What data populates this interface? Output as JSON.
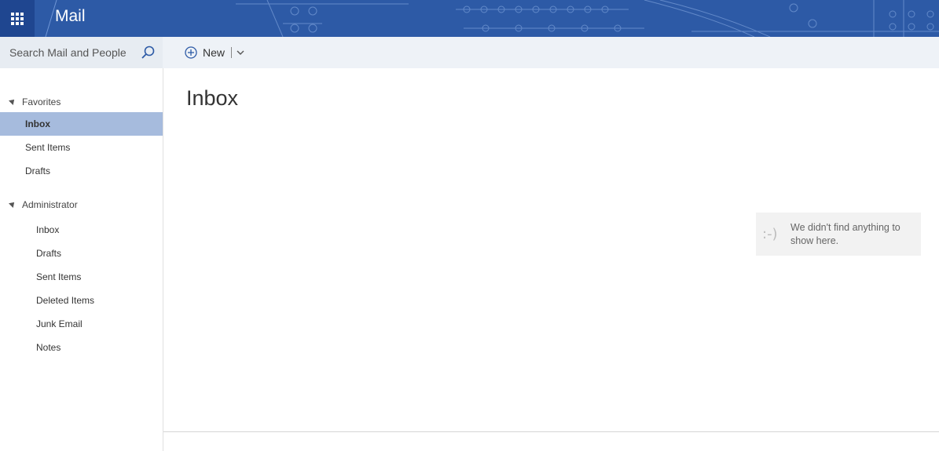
{
  "app": {
    "title": "Mail"
  },
  "search": {
    "placeholder": "Search Mail and People"
  },
  "toolbar": {
    "new_label": "New"
  },
  "sidebar": {
    "favorites": {
      "label": "Favorites",
      "items": [
        {
          "label": "Inbox",
          "selected": true
        },
        {
          "label": "Sent Items"
        },
        {
          "label": "Drafts"
        }
      ]
    },
    "account": {
      "label": "Administrator",
      "items": [
        {
          "label": "Inbox"
        },
        {
          "label": "Drafts"
        },
        {
          "label": "Sent Items"
        },
        {
          "label": "Deleted Items"
        },
        {
          "label": "Junk Email"
        },
        {
          "label": "Notes"
        }
      ]
    }
  },
  "main": {
    "folder_title": "Inbox",
    "empty_icon": ":-)",
    "empty_message": "We didn't find anything to show here."
  },
  "colors": {
    "header": "#2d5aa6",
    "selected": "#a6bbdd",
    "commandbar": "#eef2f7"
  }
}
